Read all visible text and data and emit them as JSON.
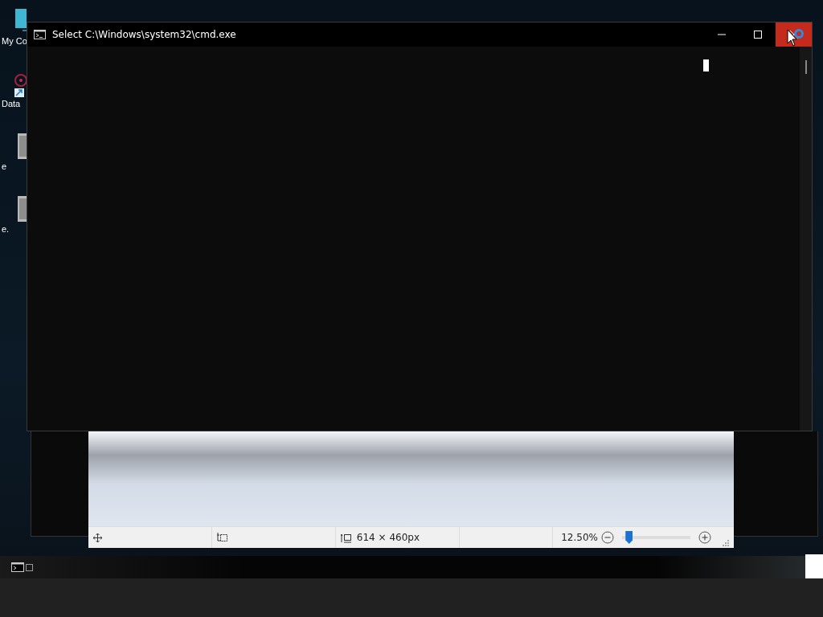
{
  "desktop_icons": [
    {
      "label": "My Co",
      "kind": "monitor"
    },
    {
      "label": "Data",
      "kind": "shortcut"
    },
    {
      "label": "e",
      "kind": "file"
    },
    {
      "label": "e.",
      "kind": "file"
    }
  ],
  "console": {
    "title": "Select C:\\Windows\\system32\\cmd.exe"
  },
  "image_editor": {
    "status_bar": {
      "dimensions": "614 × 460px",
      "zoom": "12.50%",
      "zoom_slider": {
        "level": 0.05
      }
    }
  }
}
